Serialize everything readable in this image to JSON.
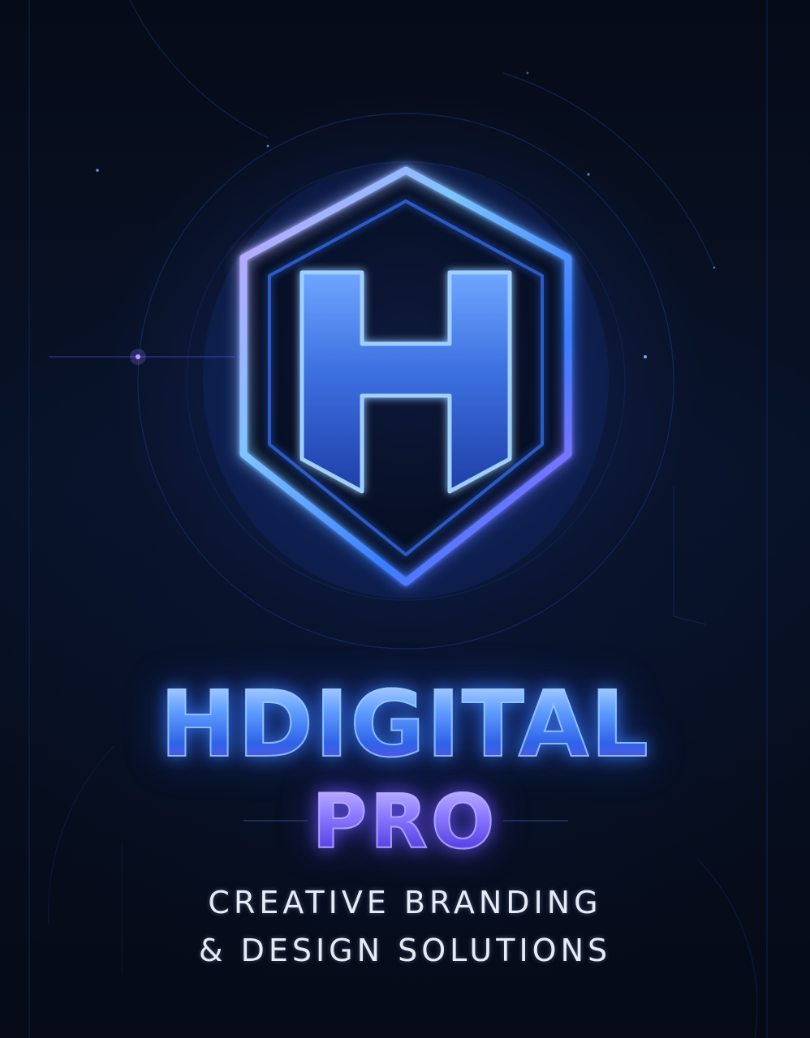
{
  "brand": {
    "title": "HDIGITAL",
    "subtitle": "PRO",
    "monogram": "H",
    "tagline_line1": "CREATIVE BRANDING",
    "tagline_line2": "& DESIGN SOLUTIONS"
  },
  "emblem": {
    "icon": "hexagon-shield-h-icon"
  },
  "colors": {
    "background": "#050a16",
    "neon_blue": "#3d8bff",
    "neon_cyan": "#8fd0ff",
    "neon_violet": "#b46bff",
    "tagline_text": "#e6ebf5"
  }
}
